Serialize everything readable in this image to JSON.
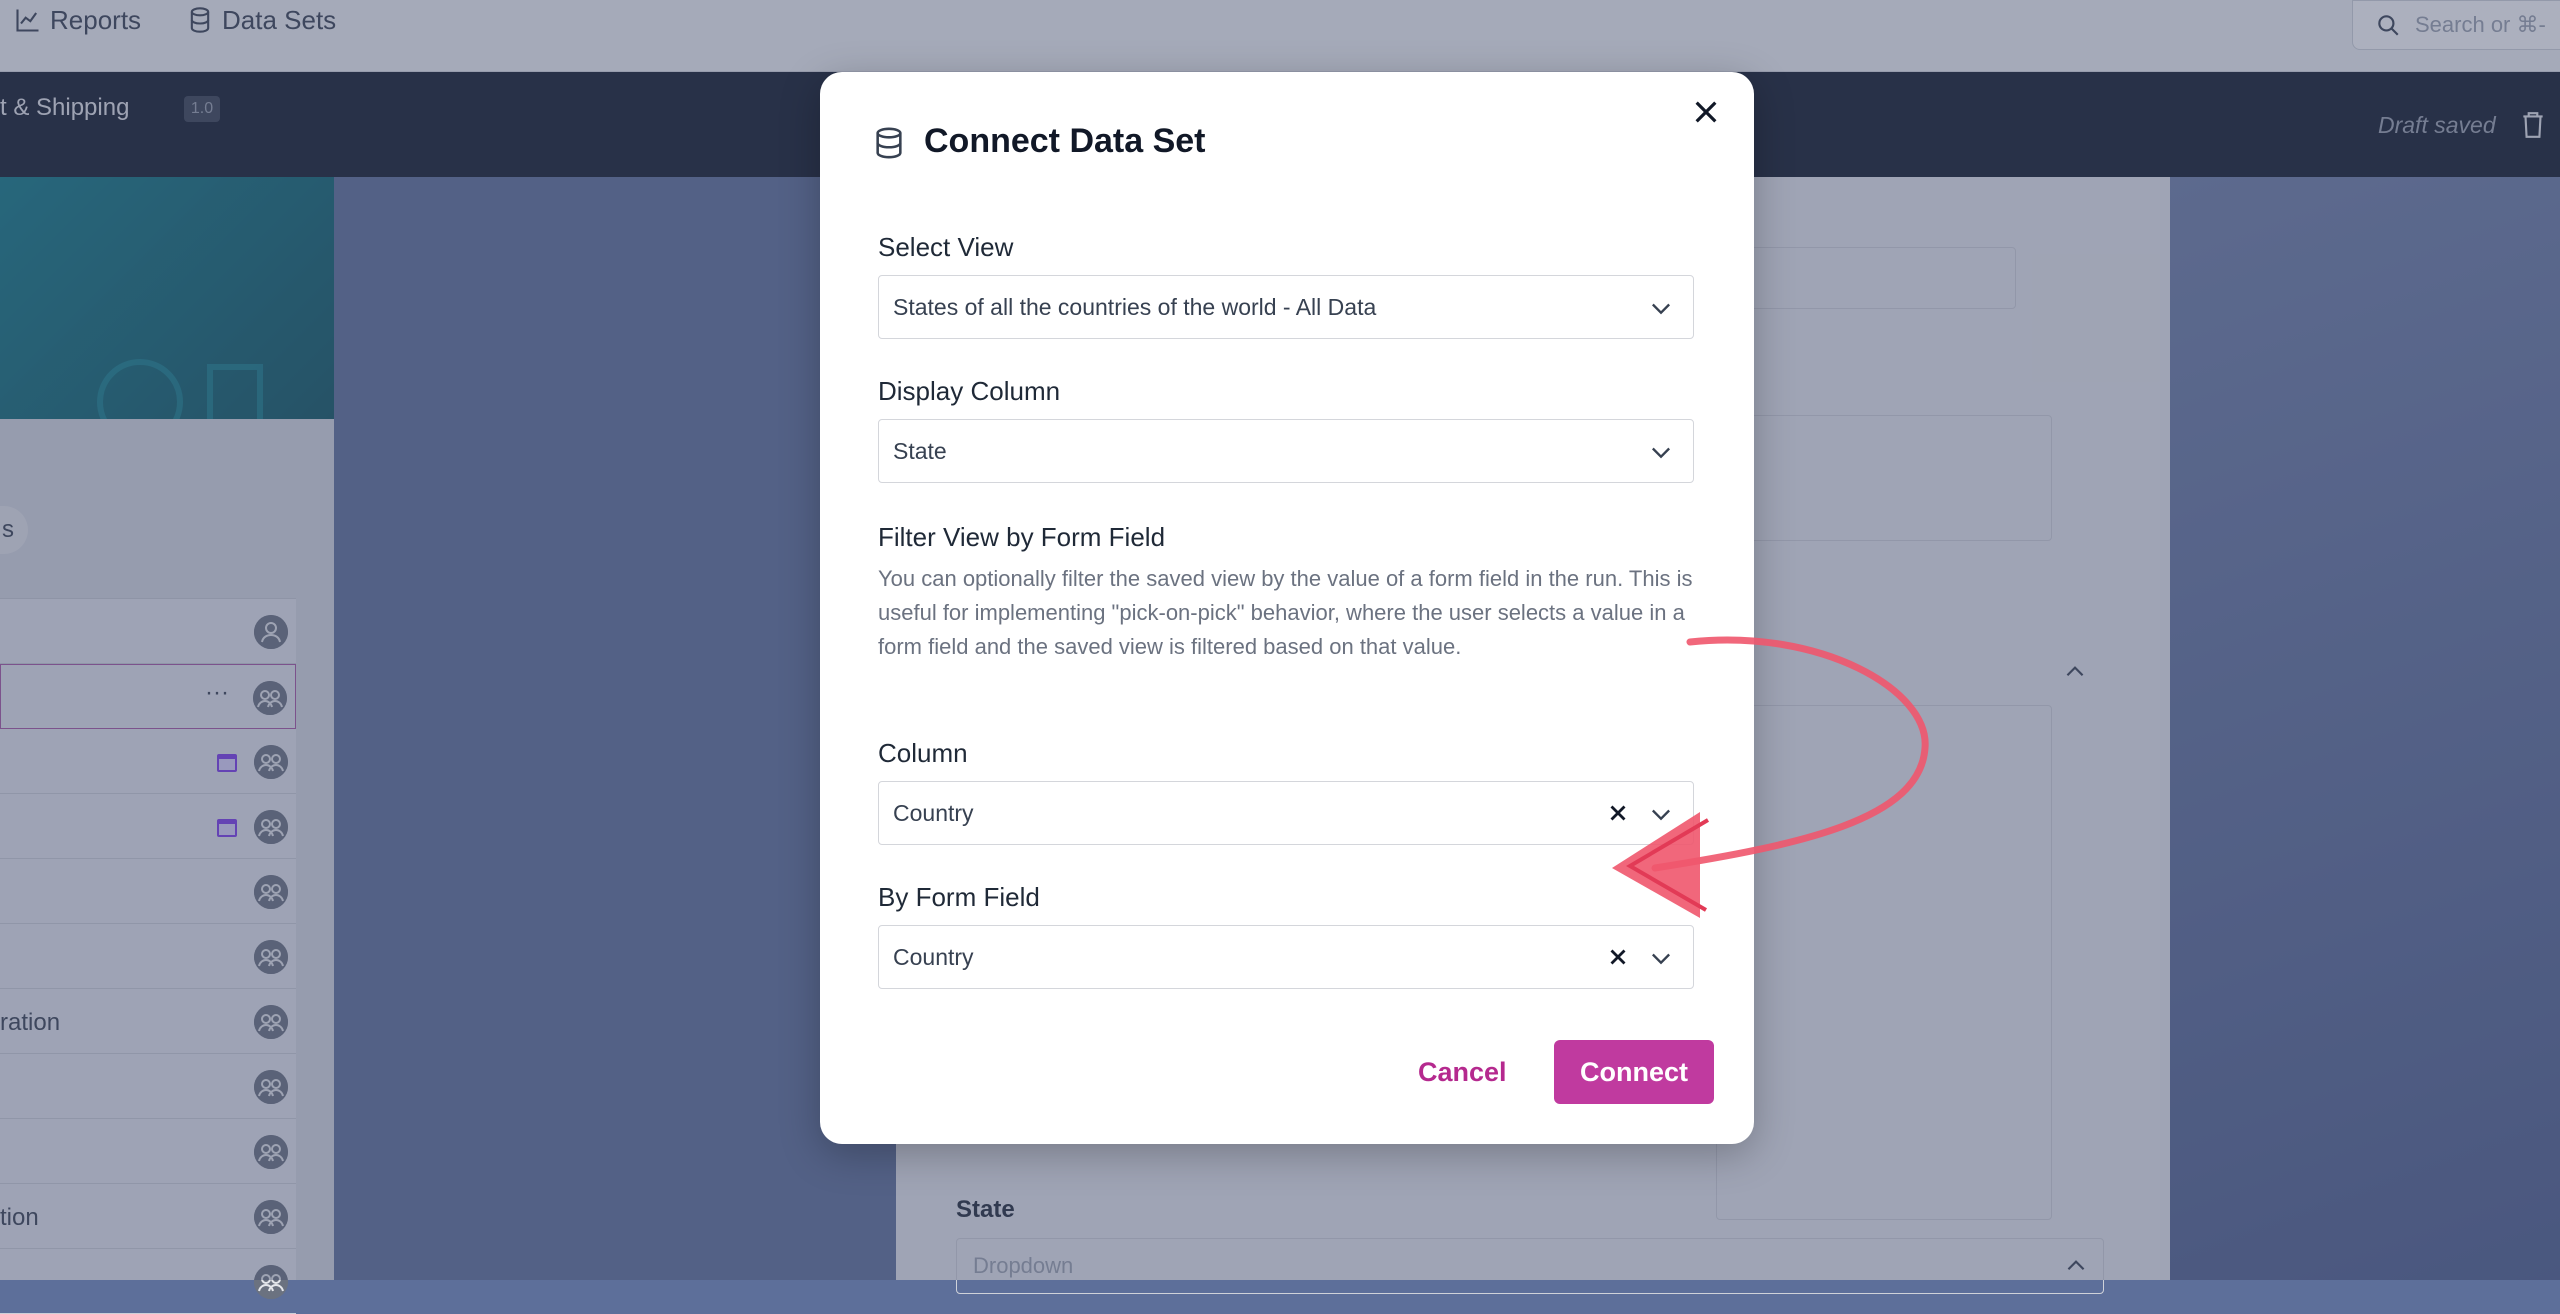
{
  "topnav": {
    "reports_label": "Reports",
    "datasets_label": "Data Sets",
    "search_placeholder": "Search or ⌘-"
  },
  "form_header": {
    "title_fragment": "t & Shipping",
    "version": "1.0",
    "status": "Draft saved"
  },
  "left_list": {
    "pill_label": "s",
    "rows": [
      {
        "label": ""
      },
      {
        "label": ""
      },
      {
        "label": ""
      },
      {
        "label": ""
      },
      {
        "label": ""
      },
      {
        "label": ""
      },
      {
        "label": "ration"
      },
      {
        "label": ""
      },
      {
        "label": ""
      },
      {
        "label": "tion"
      },
      {
        "label": ""
      }
    ]
  },
  "canvas": {
    "state_label": "State",
    "state_type": "Dropdown"
  },
  "modal": {
    "title": "Connect Data Set",
    "select_view": {
      "label": "Select View",
      "value": "States of all the countries of the world - All Data"
    },
    "display_column": {
      "label": "Display Column",
      "value": "State"
    },
    "filter": {
      "heading": "Filter View by Form Field",
      "help": "You can optionally filter the saved view by the value of a form field in the run. This is useful for implementing \"pick-on-pick\" behavior, where the user selects a value in a form field and the saved view is filtered based on that value."
    },
    "column": {
      "label": "Column",
      "value": "Country"
    },
    "by_form_field": {
      "label": "By Form Field",
      "value": "Country"
    },
    "cancel_label": "Cancel",
    "connect_label": "Connect"
  },
  "colors": {
    "accent": "#c03a9f",
    "annotation_arrow": "#f0566d",
    "header_dark": "#101829"
  },
  "icons": {
    "reports": "line-chart-icon",
    "datasets": "database-icon",
    "search": "search-icon",
    "trash": "trash-icon",
    "close": "close-icon",
    "chevron": "chevron-down-icon",
    "clear": "clear-x-icon"
  }
}
